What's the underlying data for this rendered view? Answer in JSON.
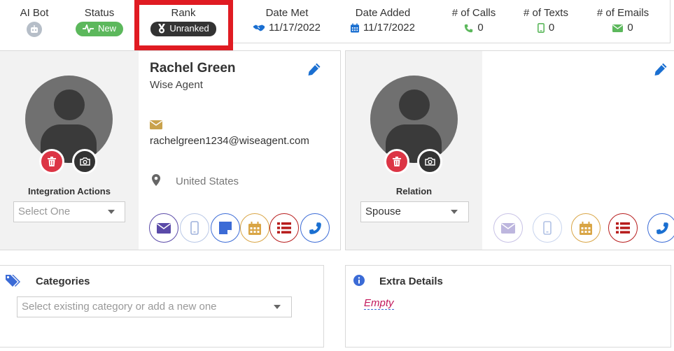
{
  "stats": {
    "ai_bot": {
      "label": "AI Bot"
    },
    "status": {
      "label": "Status",
      "value": "New"
    },
    "rank": {
      "label": "Rank",
      "value": "Unranked"
    },
    "date_met": {
      "label": "Date Met",
      "value": "11/17/2022"
    },
    "date_added": {
      "label": "Date Added",
      "value": "11/17/2022"
    },
    "calls": {
      "label": "# of Calls",
      "value": "0"
    },
    "texts": {
      "label": "# of Texts",
      "value": "0"
    },
    "emails": {
      "label": "# of Emails",
      "value": "0"
    }
  },
  "contact": {
    "name": "Rachel Green",
    "company": "Wise Agent",
    "email": "rachelgreen1234@wiseagent.com",
    "country": "United States",
    "integration_label": "Integration Actions",
    "integration_placeholder": "Select One"
  },
  "spouse": {
    "relation_label": "Relation",
    "relation_value": "Spouse"
  },
  "categories": {
    "title": "Categories",
    "placeholder": "Select existing category or add a new one"
  },
  "extra_details": {
    "title": "Extra Details",
    "value": "Empty"
  },
  "colors": {
    "accent_blue": "#1a6fd1",
    "green": "#5cb85c",
    "red": "#dc3545",
    "gold": "#c9a24c",
    "highlight_red": "#e01b22"
  }
}
